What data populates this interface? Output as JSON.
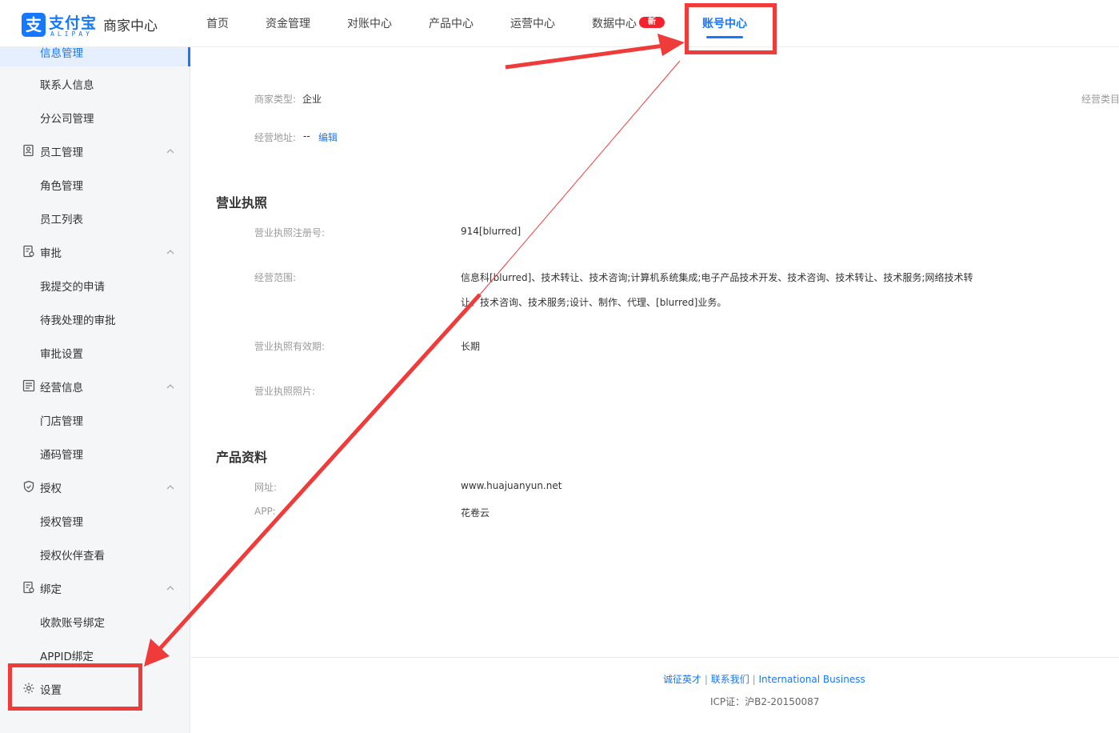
{
  "header": {
    "logo_cn": "支付宝",
    "logo_en": "ALIPAY",
    "app_name": "商家中心",
    "nav": [
      "首页",
      "资金管理",
      "对账中心",
      "产品中心",
      "运营中心",
      "数据中心",
      "账号中心"
    ],
    "new_badge": "新",
    "active_nav": "账号中心"
  },
  "sidebar": {
    "active_item": "信息管理",
    "items": {
      "contact": "联系人信息",
      "branch": "分公司管理",
      "staff_group": "员工管理",
      "role": "角色管理",
      "staff_list": "员工列表",
      "approval_group": "审批",
      "my_submitted": "我提交的申请",
      "pending": "待我处理的审批",
      "approval_settings": "审批设置",
      "business_group": "经营信息",
      "store": "门店管理",
      "code": "通码管理",
      "auth_group": "授权",
      "auth_manage": "授权管理",
      "auth_partner": "授权伙伴查看",
      "bind_group": "绑定",
      "receive_bind": "收款账号绑定",
      "appid_bind": "APPID绑定",
      "settings": "设置"
    }
  },
  "main": {
    "merchant_type_label": "商家类型:",
    "merchant_type_value": "企业",
    "category_label": "经营类目",
    "address_label": "经营地址:",
    "address_value": "--",
    "edit_link": "编辑",
    "license_title": "营业执照",
    "license_no_label": "营业执照注册号:",
    "license_no_value": "914[blurred]",
    "scope_label": "经营范围:",
    "scope_line1": "信息科[blurred]、技术转让、技术咨询;计算机系统集成;电子产品技术开发、技术咨询、技术转让、技术服务;网络技术转",
    "scope_line2": "让、技术咨询、技术服务;设计、制作、代理、[blurred]业务。",
    "validity_label": "营业执照有效期:",
    "validity_value": "长期",
    "photo_label": "营业执照照片:",
    "product_title": "产品资料",
    "website_label": "网址:",
    "website_value": "www.huajuanyun.net",
    "app_label": "APP:",
    "app_value": "花卷云"
  },
  "footer": {
    "links": [
      "诚征英才",
      "联系我们",
      "International Business"
    ],
    "separator": "|",
    "icp": "ICP证：沪B2-20150087"
  },
  "colors": {
    "primary": "#1677ff",
    "annotation_red": "#f03b3b",
    "badge_red": "#f5222d",
    "sidebar_bg": "#f5f6f8"
  }
}
